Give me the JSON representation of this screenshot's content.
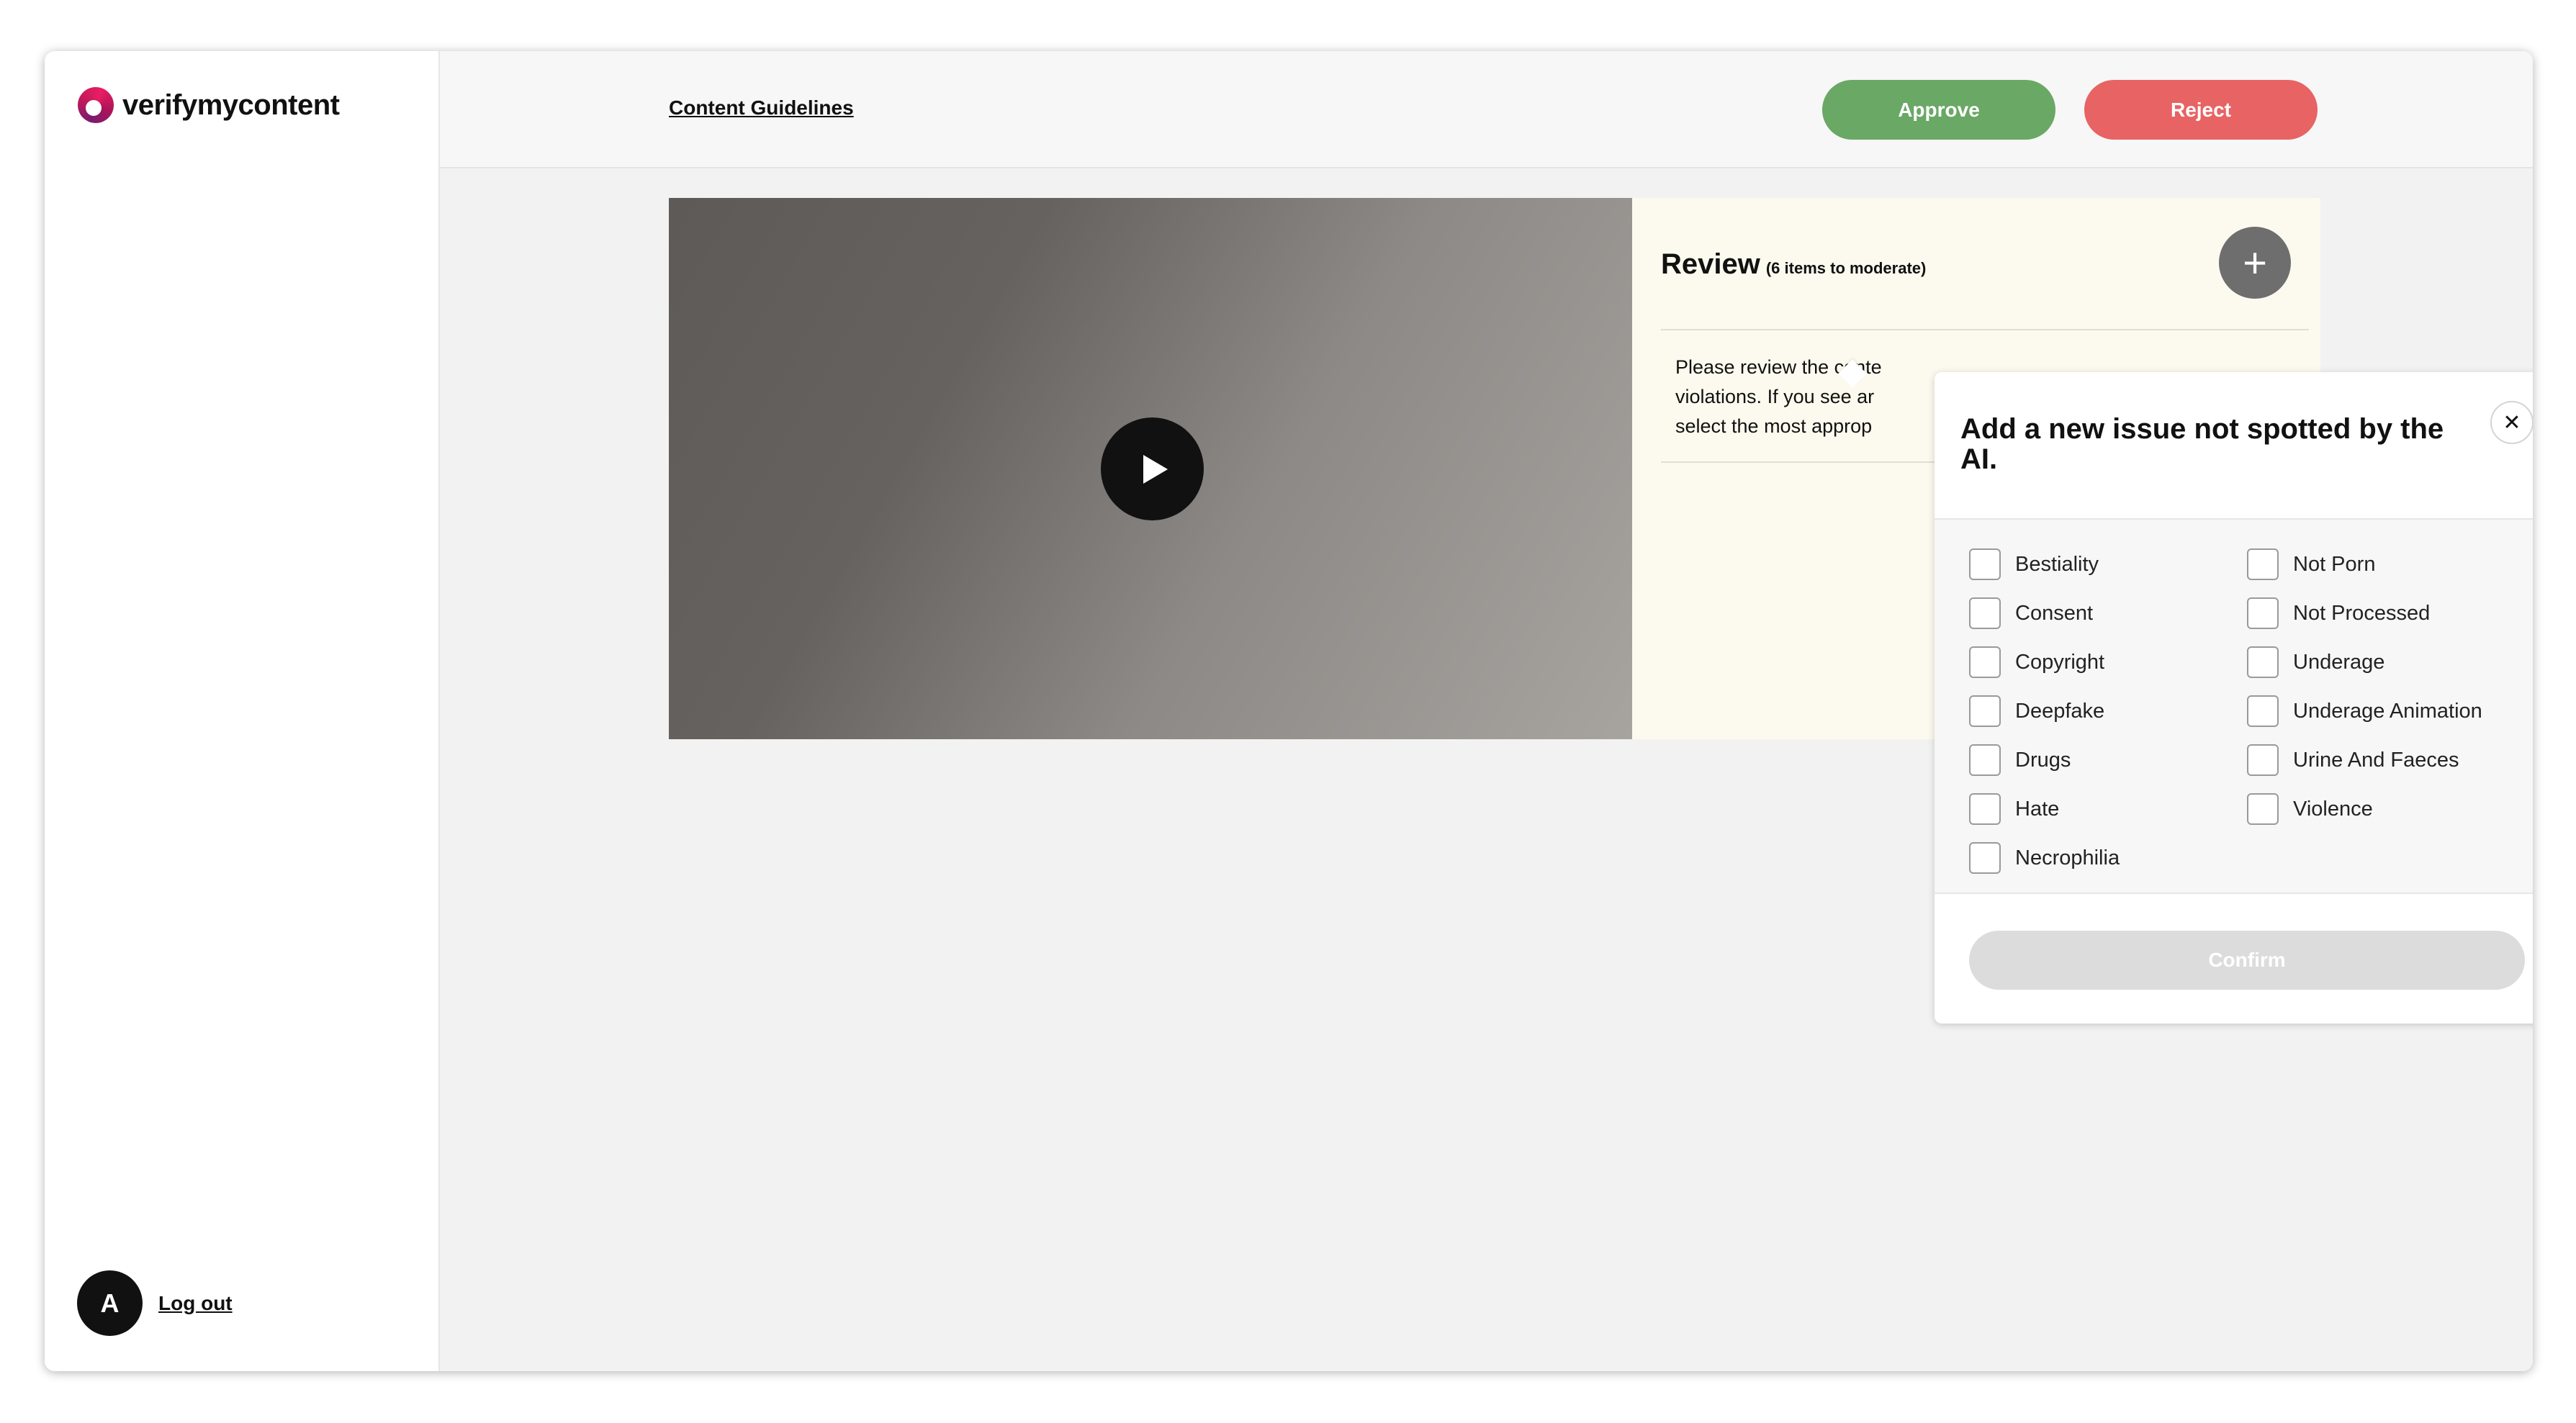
{
  "brand": {
    "name": "verifymycontent"
  },
  "user": {
    "initial": "A",
    "logout_label": "Log out"
  },
  "header": {
    "guidelines_label": "Content Guidelines",
    "approve_label": "Approve",
    "reject_label": "Reject"
  },
  "colors": {
    "approve": "#6aa865",
    "reject": "#e86363",
    "review_bg": "#fcfaee",
    "brand_accent": "#c2185b"
  },
  "review": {
    "title": "Review",
    "subtitle": "(6 items to moderate)",
    "add_icon": "plus-icon",
    "instruction_lines": [
      "Please review the conte",
      "violations. If you see ar",
      "select the most approp"
    ]
  },
  "popup": {
    "title": "Add a new issue not spotted by the AI.",
    "close_icon": "close-icon",
    "left_options": [
      "Bestiality",
      "Consent",
      "Copyright",
      "Deepfake",
      "Drugs",
      "Hate",
      "Necrophilia"
    ],
    "right_options": [
      "Not Porn",
      "Not Processed",
      "Underage",
      "Underage Animation",
      "Urine And Faeces",
      "Violence"
    ],
    "confirm_label": "Confirm"
  }
}
